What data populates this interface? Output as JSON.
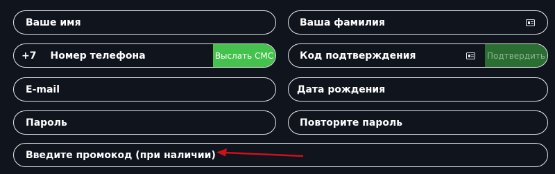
{
  "form": {
    "first_name": {
      "placeholder": "Ваше имя"
    },
    "last_name": {
      "placeholder": "Ваша фамилия"
    },
    "phone": {
      "prefix": "+7",
      "placeholder": "Номер телефона",
      "send_sms_label": "Выслать СМС"
    },
    "code": {
      "placeholder": "Код подтверждения",
      "confirm_label": "Подтвердить"
    },
    "email": {
      "placeholder": "E-mail"
    },
    "birth_date": {
      "placeholder": "Дата рождения"
    },
    "password": {
      "placeholder": "Пароль"
    },
    "password_repeat": {
      "placeholder": "Повторите пароль"
    },
    "promo": {
      "placeholder": "Введите промокод (при наличии)"
    }
  },
  "icons": {
    "last_name_icon": "id-card-icon",
    "code_icon": "id-card-icon",
    "annotation": "red-arrow-icon"
  },
  "colors": {
    "background": "#0f141d",
    "border": "#e9ecef",
    "sms_button": "#45c24d",
    "confirm_button_disabled": "#2b6e33",
    "arrow": "#d0101b"
  }
}
